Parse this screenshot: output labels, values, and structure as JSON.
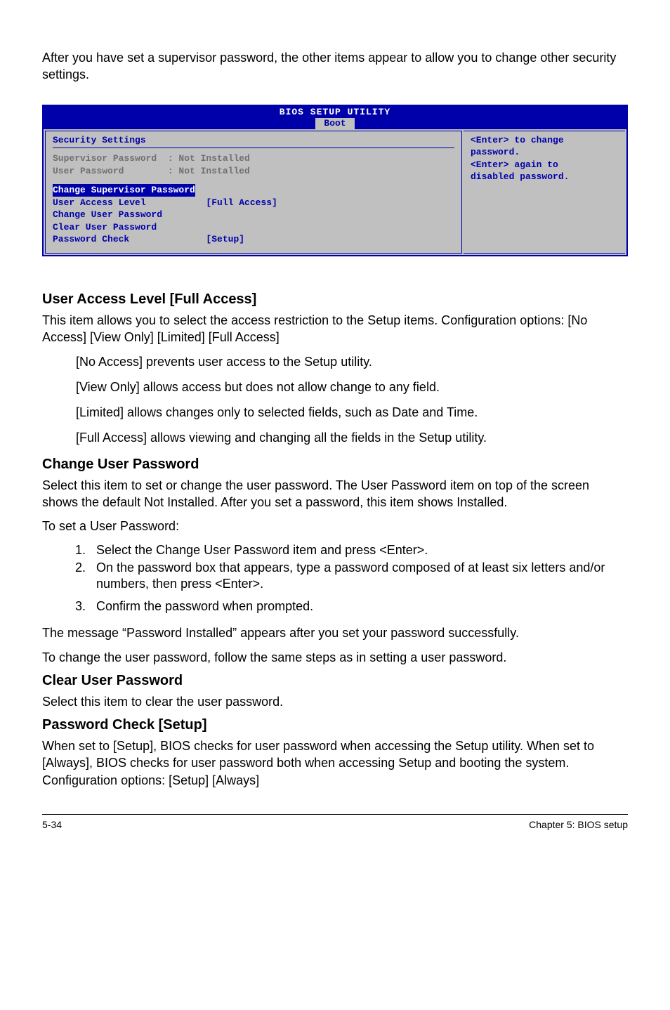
{
  "intro": "After you have set a supervisor password, the other items appear to allow you to change other security settings.",
  "bios": {
    "title": "BIOS SETUP UTILITY",
    "tab": "Boot",
    "sectionTitle": "Security Settings",
    "supLabel": "Supervisor Password  : Not Installed",
    "userLabel": "User Password        : Not Installed",
    "changeSup": "Change Supervisor Password",
    "ual": "User Access Level           [Full Access]",
    "changeUser": "Change User Password",
    "clearUser": "Clear User Password",
    "pwdCheck": "Password Check              [Setup]",
    "help1": "<Enter> to change",
    "help2": "password.",
    "help3": "<Enter> again to",
    "help4": "disabled password."
  },
  "sec1": {
    "h": "User Access Level [Full Access]",
    "p1": "This item allows you to select the access restriction to the Setup items. Configuration options: [No Access] [View Only] [Limited] [Full Access]",
    "b1": "[No Access] prevents user access to the Setup utility.",
    "b2": "[View Only] allows access but does not allow change to any field.",
    "b3": "[Limited] allows changes only to selected fields, such as Date and Time.",
    "b4": "[Full Access] allows viewing and changing all the fields in the Setup utility."
  },
  "sec2": {
    "h": "Change User Password",
    "p1": "Select this item to set or change the user password. The User Password item on top of the screen shows the default Not Installed. After you set a password, this item shows Installed.",
    "p2": "To set a User Password:",
    "s1": "Select the Change User Password item and press <Enter>.",
    "s2": "On the password box that appears, type a password composed of at least six letters and/or numbers, then press <Enter>.",
    "s3": "Confirm the password when prompted.",
    "p3": "The message “Password Installed” appears after you set your password successfully.",
    "p4": "To change the user password, follow the same steps as in setting a user password."
  },
  "sec3": {
    "h": "Clear User Password",
    "p1": "Select this item to clear the user password."
  },
  "sec4": {
    "h": "Password Check [Setup]",
    "p1": "When set to [Setup], BIOS checks for user password when accessing the Setup utility. When set to [Always], BIOS checks for user password both when accessing Setup and booting the system. Configuration options: [Setup] [Always]"
  },
  "footer": {
    "left": "5-34",
    "right": "Chapter 5: BIOS setup"
  }
}
